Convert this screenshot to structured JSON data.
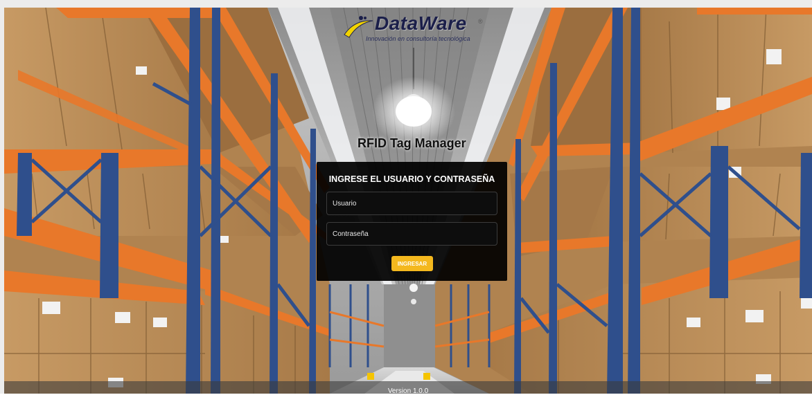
{
  "brand": {
    "name": "DataWare",
    "registered_mark": "®",
    "tagline": "Innovación en consultoría tecnológica"
  },
  "app": {
    "title": "RFID Tag Manager"
  },
  "login": {
    "heading": "INGRESE EL USUARIO Y CONTRASEÑA",
    "username_placeholder": "Usuario",
    "password_placeholder": "Contraseña",
    "submit_label": "INGRESAR"
  },
  "footer": {
    "version": "Version 1.0.0"
  },
  "colors": {
    "button": "#f4b81e",
    "panel": "#000000",
    "shelf_beam": "#e8782a",
    "shelf_upright": "#2f4f8c",
    "box": "#b98a55"
  },
  "icons": [
    "swoosh-logo-icon",
    "ceiling-lamp-icon"
  ]
}
